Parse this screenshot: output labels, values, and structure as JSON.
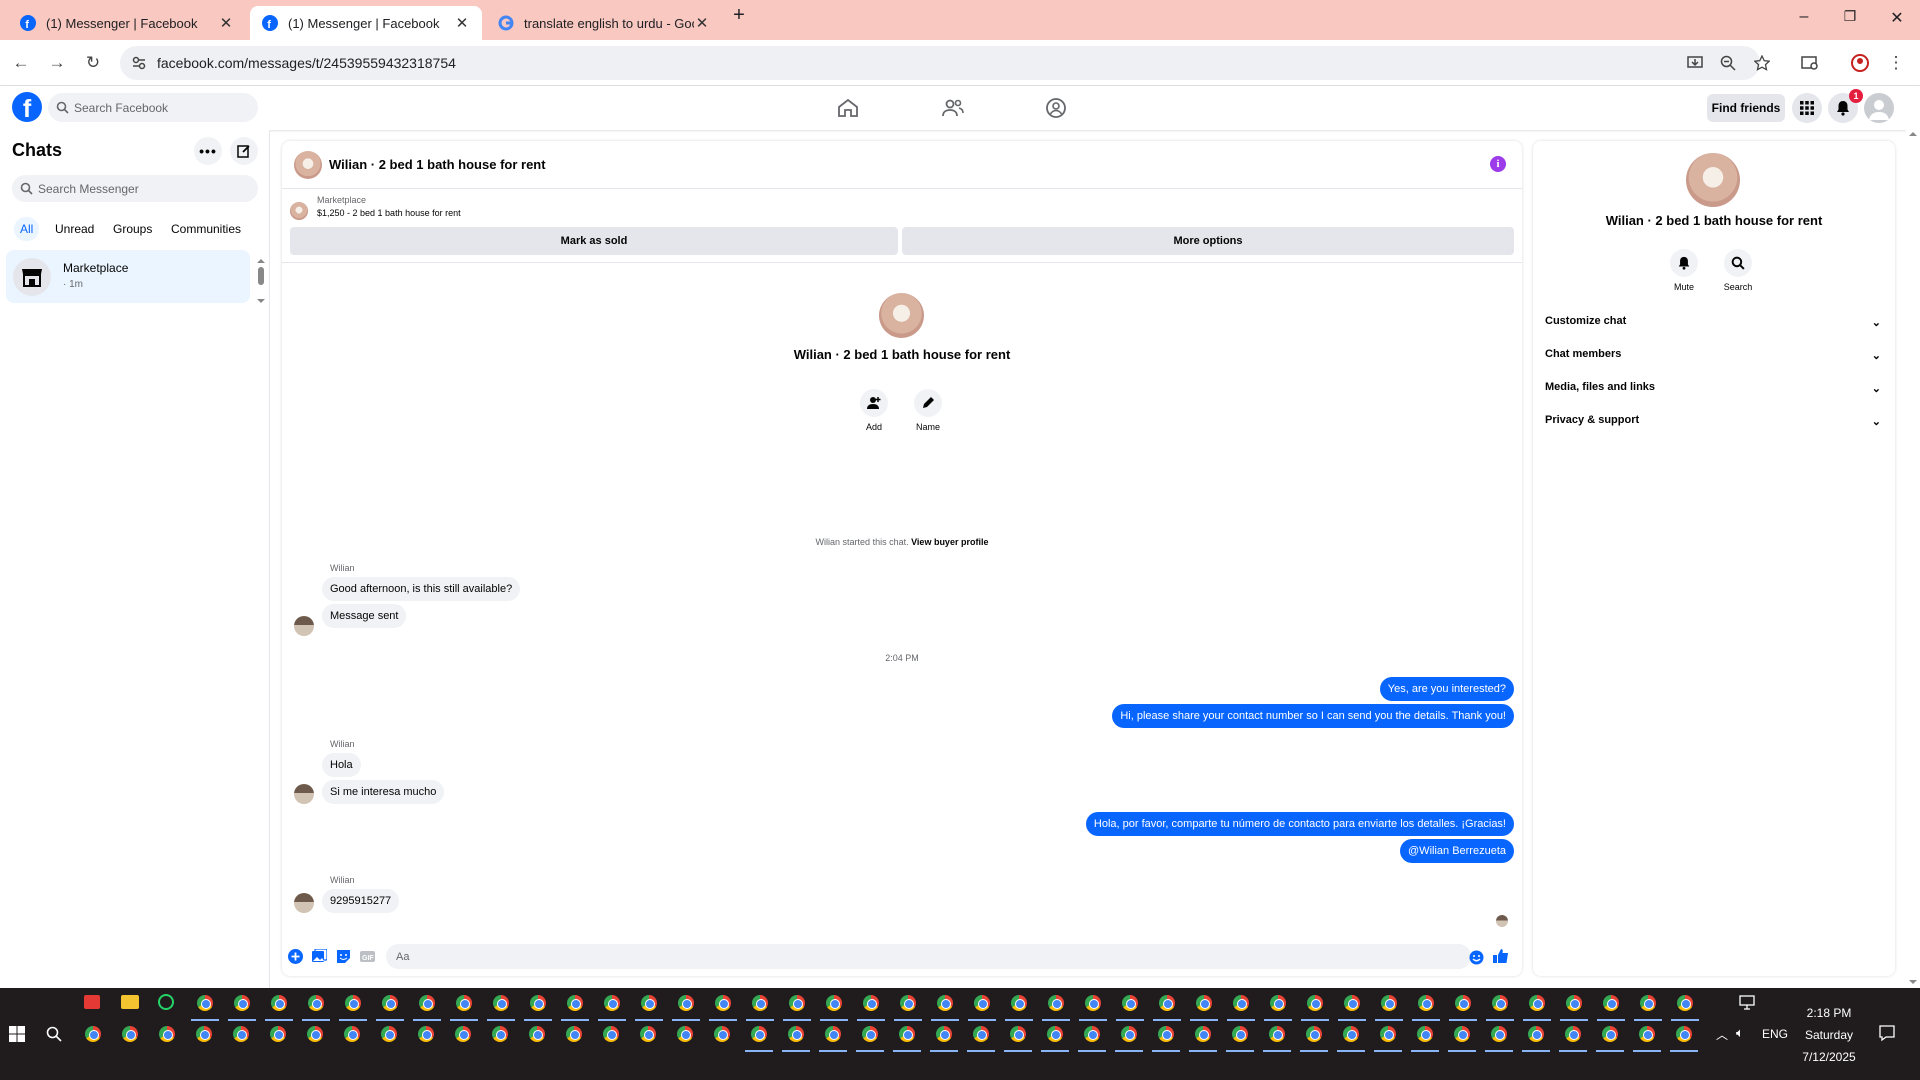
{
  "browser": {
    "tabs": [
      {
        "title": "(1) Messenger | Facebook",
        "active": false
      },
      {
        "title": "(1) Messenger | Facebook",
        "active": true
      },
      {
        "title": "translate english to urdu - Goo",
        "active": false
      }
    ],
    "url": "facebook.com/messages/t/24539559432318754"
  },
  "fb": {
    "search_placeholder": "Search Facebook",
    "find_friends": "Find friends",
    "notification_count": "1"
  },
  "sidebar": {
    "title": "Chats",
    "search_placeholder": "Search Messenger",
    "filters": [
      "All",
      "Unread",
      "Groups",
      "Communities"
    ],
    "conversations": [
      {
        "name": "Marketplace",
        "time": "· 1m"
      }
    ]
  },
  "chat": {
    "header_name": "Wilian · 2 bed 1 bath house for rent",
    "marketplace_label": "Marketplace",
    "listing": "$1,250 - 2 bed 1 bath house for rent",
    "mark_sold": "Mark as sold",
    "more_options": "More options",
    "intro_name": "Wilian · 2 bed 1 bath house for rent",
    "intro_add": "Add",
    "intro_name_btn": "Name",
    "started_text": "Wilian started this chat. ",
    "started_link": "View buyer profile",
    "time_separator": "2:04 PM",
    "messages": [
      {
        "from": "Wilian",
        "text": "Good afternoon, is this still available?"
      },
      {
        "from": "Wilian",
        "text": "Message sent"
      },
      {
        "from": "me",
        "text": "Yes, are you interested?"
      },
      {
        "from": "me",
        "text": "Hi, please share your contact number so I can send you the details. Thank you!"
      },
      {
        "from": "Wilian",
        "text": "Hola"
      },
      {
        "from": "Wilian",
        "text": "Si me interesa mucho"
      },
      {
        "from": "me",
        "text": "Hola, por favor, comparte tu número de contacto para enviarte los detalles. ¡Gracias!"
      },
      {
        "from": "me",
        "text": "@Wilian Berrezueta"
      },
      {
        "from": "Wilian",
        "text": "9295915277"
      }
    ],
    "sender_name": "Wilian",
    "composer_placeholder": "Aa"
  },
  "right_panel": {
    "name": "Wilian · 2 bed 1 bath house for rent",
    "mute": "Mute",
    "search": "Search",
    "sections": [
      "Customize chat",
      "Chat members",
      "Media, files and links",
      "Privacy & support"
    ]
  },
  "taskbar": {
    "time": "2:18 PM",
    "day": "Saturday",
    "date": "7/12/2025",
    "lang": "ENG"
  },
  "colors": {
    "fb_blue": "#0866ff",
    "tab_strip": "#f9c8c0",
    "info_purple": "#9d3bea"
  }
}
